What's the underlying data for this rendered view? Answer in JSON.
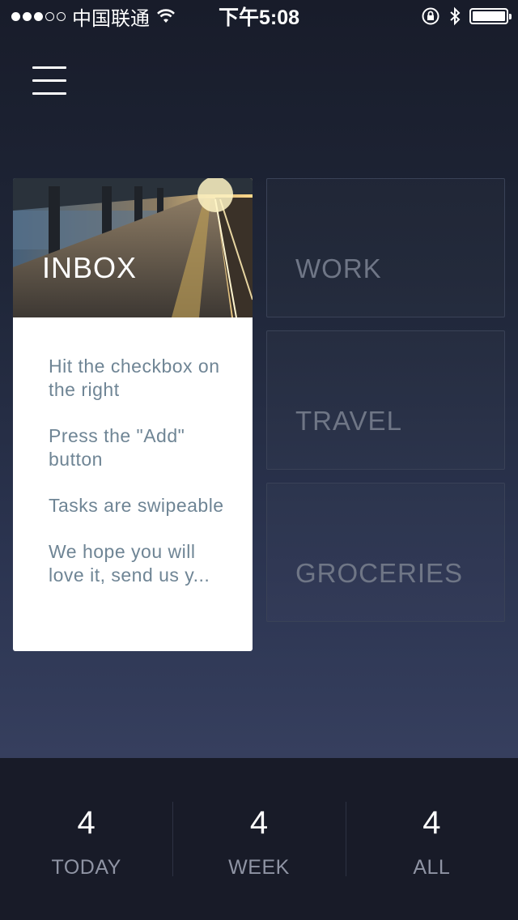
{
  "status_bar": {
    "carrier": "中国联通",
    "time": "下午5:08",
    "signal_bars_filled": 3,
    "signal_bars_total": 5
  },
  "menu": {
    "icon": "hamburger-menu-icon"
  },
  "inbox": {
    "title": "INBOX",
    "tasks": [
      "Hit the checkbox on the right",
      "Press the \"Add\" button",
      "Tasks are swipeable",
      "We hope you will love it, send us y..."
    ]
  },
  "categories": [
    {
      "label": "WORK"
    },
    {
      "label": "TRAVEL"
    },
    {
      "label": "GROCERIES"
    }
  ],
  "stats": [
    {
      "count": "4",
      "label": "TODAY"
    },
    {
      "count": "4",
      "label": "WEEK"
    },
    {
      "count": "4",
      "label": "ALL"
    }
  ]
}
